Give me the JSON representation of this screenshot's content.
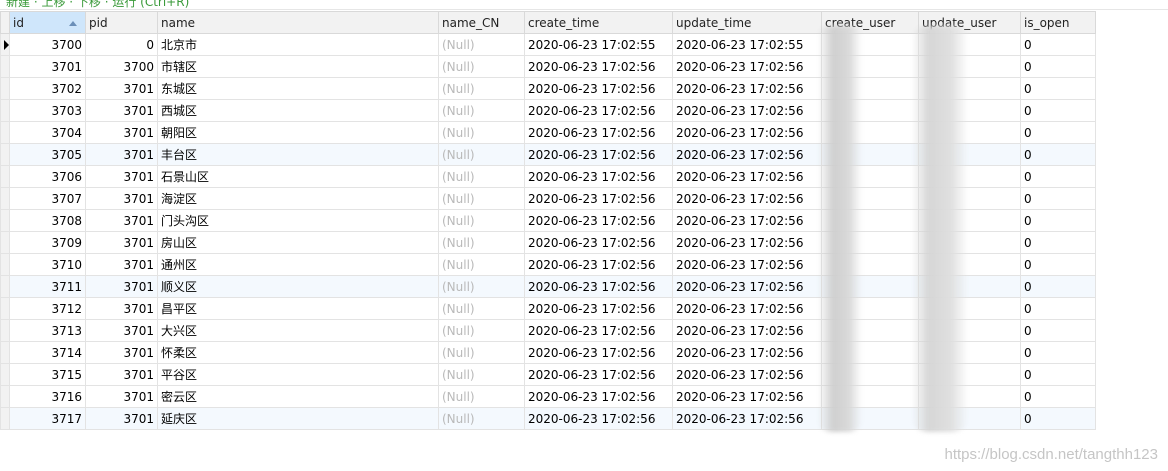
{
  "toolbar": {
    "crumb_visible": "新建 · 上移 · 下移 · 运行 (Ctrl+R)"
  },
  "columns": [
    "id",
    "pid",
    "name",
    "name_CN",
    "create_time",
    "update_time",
    "create_user",
    "update_user",
    "is_open"
  ],
  "sorted_column": "id",
  "rows": [
    {
      "id": "3700",
      "pid": "0",
      "name": "北京市",
      "name_cn": "(Null)",
      "create_time": "2020-06-23 17:02:55",
      "update_time": "2020-06-23 17:02:55",
      "create_user": "",
      "update_user": "",
      "is_open": "0"
    },
    {
      "id": "3701",
      "pid": "3700",
      "name": "市辖区",
      "name_cn": "(Null)",
      "create_time": "2020-06-23 17:02:56",
      "update_time": "2020-06-23 17:02:56",
      "create_user": "",
      "update_user": "",
      "is_open": "0"
    },
    {
      "id": "3702",
      "pid": "3701",
      "name": "东城区",
      "name_cn": "(Null)",
      "create_time": "2020-06-23 17:02:56",
      "update_time": "2020-06-23 17:02:56",
      "create_user": "",
      "update_user": "",
      "is_open": "0"
    },
    {
      "id": "3703",
      "pid": "3701",
      "name": "西城区",
      "name_cn": "(Null)",
      "create_time": "2020-06-23 17:02:56",
      "update_time": "2020-06-23 17:02:56",
      "create_user": "",
      "update_user": "",
      "is_open": "0"
    },
    {
      "id": "3704",
      "pid": "3701",
      "name": "朝阳区",
      "name_cn": "(Null)",
      "create_time": "2020-06-23 17:02:56",
      "update_time": "2020-06-23 17:02:56",
      "create_user": "",
      "update_user": "",
      "is_open": "0"
    },
    {
      "id": "3705",
      "pid": "3701",
      "name": "丰台区",
      "name_cn": "(Null)",
      "create_time": "2020-06-23 17:02:56",
      "update_time": "2020-06-23 17:02:56",
      "create_user": "",
      "update_user": "",
      "is_open": "0"
    },
    {
      "id": "3706",
      "pid": "3701",
      "name": "石景山区",
      "name_cn": "(Null)",
      "create_time": "2020-06-23 17:02:56",
      "update_time": "2020-06-23 17:02:56",
      "create_user": "",
      "update_user": "",
      "is_open": "0"
    },
    {
      "id": "3707",
      "pid": "3701",
      "name": "海淀区",
      "name_cn": "(Null)",
      "create_time": "2020-06-23 17:02:56",
      "update_time": "2020-06-23 17:02:56",
      "create_user": "",
      "update_user": "",
      "is_open": "0"
    },
    {
      "id": "3708",
      "pid": "3701",
      "name": "门头沟区",
      "name_cn": "(Null)",
      "create_time": "2020-06-23 17:02:56",
      "update_time": "2020-06-23 17:02:56",
      "create_user": "",
      "update_user": "",
      "is_open": "0"
    },
    {
      "id": "3709",
      "pid": "3701",
      "name": "房山区",
      "name_cn": "(Null)",
      "create_time": "2020-06-23 17:02:56",
      "update_time": "2020-06-23 17:02:56",
      "create_user": "",
      "update_user": "",
      "is_open": "0"
    },
    {
      "id": "3710",
      "pid": "3701",
      "name": "通州区",
      "name_cn": "(Null)",
      "create_time": "2020-06-23 17:02:56",
      "update_time": "2020-06-23 17:02:56",
      "create_user": "",
      "update_user": "",
      "is_open": "0"
    },
    {
      "id": "3711",
      "pid": "3701",
      "name": "顺义区",
      "name_cn": "(Null)",
      "create_time": "2020-06-23 17:02:56",
      "update_time": "2020-06-23 17:02:56",
      "create_user": "",
      "update_user": "",
      "is_open": "0"
    },
    {
      "id": "3712",
      "pid": "3701",
      "name": "昌平区",
      "name_cn": "(Null)",
      "create_time": "2020-06-23 17:02:56",
      "update_time": "2020-06-23 17:02:56",
      "create_user": "",
      "update_user": "",
      "is_open": "0"
    },
    {
      "id": "3713",
      "pid": "3701",
      "name": "大兴区",
      "name_cn": "(Null)",
      "create_time": "2020-06-23 17:02:56",
      "update_time": "2020-06-23 17:02:56",
      "create_user": "",
      "update_user": "",
      "is_open": "0"
    },
    {
      "id": "3714",
      "pid": "3701",
      "name": "怀柔区",
      "name_cn": "(Null)",
      "create_time": "2020-06-23 17:02:56",
      "update_time": "2020-06-23 17:02:56",
      "create_user": "",
      "update_user": "",
      "is_open": "0"
    },
    {
      "id": "3715",
      "pid": "3701",
      "name": "平谷区",
      "name_cn": "(Null)",
      "create_time": "2020-06-23 17:02:56",
      "update_time": "2020-06-23 17:02:56",
      "create_user": "",
      "update_user": "",
      "is_open": "0"
    },
    {
      "id": "3716",
      "pid": "3701",
      "name": "密云区",
      "name_cn": "(Null)",
      "create_time": "2020-06-23 17:02:56",
      "update_time": "2020-06-23 17:02:56",
      "create_user": "",
      "update_user": "",
      "is_open": "0"
    },
    {
      "id": "3717",
      "pid": "3701",
      "name": "延庆区",
      "name_cn": "(Null)",
      "create_time": "2020-06-23 17:02:56",
      "update_time": "2020-06-23 17:02:56",
      "create_user": "",
      "update_user": "",
      "is_open": "0"
    }
  ],
  "watermark": "https://blog.csdn.net/tangthh123",
  "colors": {
    "header_bg": "#f2f2f2",
    "sorted_header_bg": "#cfe6fb",
    "alt_row_bg": "#f4f9fe",
    "null_text": "#b9b9b9"
  }
}
